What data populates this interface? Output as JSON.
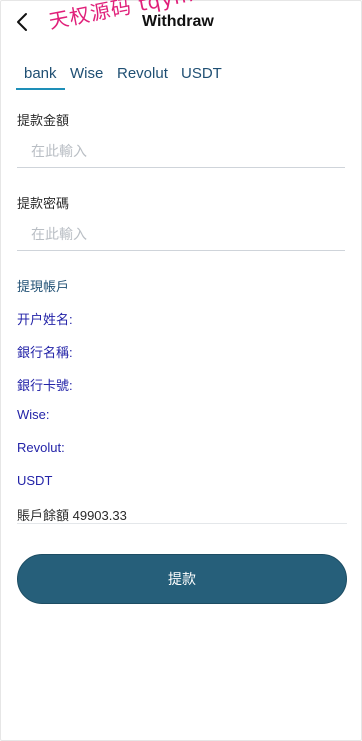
{
  "header": {
    "title": "Withdraw",
    "watermark": "天权源码 tqym"
  },
  "tabs": [
    {
      "label": "bank",
      "active": true
    },
    {
      "label": "Wise",
      "active": false
    },
    {
      "label": "Revolut",
      "active": false
    },
    {
      "label": "USDT",
      "active": false
    }
  ],
  "form": {
    "amount_label": "提款金額",
    "amount_placeholder": "在此輸入",
    "password_label": "提款密碼",
    "password_placeholder": "在此輸入",
    "account_heading": "提現帳戶",
    "account_name_label": "开户姓名:",
    "bank_name_label": "銀行名稱:",
    "bank_card_label": "銀行卡號:",
    "wise_label": "Wise:",
    "revolut_label": "Revolut:",
    "usdt_label": "USDT",
    "balance_text": "賬戶餘額 49903.33",
    "submit_label": "提款"
  },
  "colors": {
    "accent": "#265f7a",
    "tab_underline": "#1e8fb8",
    "info_text": "#2323a8",
    "watermark": "#e0207a"
  },
  "icons": {
    "back": "chevron-left-icon"
  }
}
